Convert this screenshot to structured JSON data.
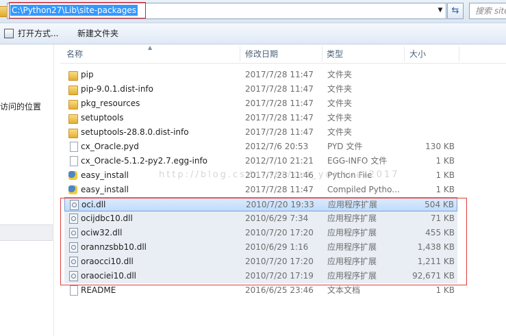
{
  "address_bar": {
    "path": "C:\\Python27\\Lib\\site-packages",
    "dropdown_icon": "chevron-down-icon",
    "refresh_icon": "refresh-icon",
    "search_placeholder": "搜索 site"
  },
  "toolbar": {
    "open_with_label": "打开方式...",
    "new_folder_label": "新建文件夹"
  },
  "nav_pane": {
    "recent_places_label": "访问的位置"
  },
  "columns": {
    "name": "名称",
    "date": "修改日期",
    "type": "类型",
    "size": "大小"
  },
  "watermark": "http://blog.csdn.net/cui_yonhua/2017",
  "files": [
    {
      "name": "pip",
      "date": "2017/7/28 11:47",
      "type": "文件夹",
      "size": "",
      "icon": "folder-icon"
    },
    {
      "name": "pip-9.0.1.dist-info",
      "date": "2017/7/28 11:47",
      "type": "文件夹",
      "size": "",
      "icon": "folder-icon"
    },
    {
      "name": "pkg_resources",
      "date": "2017/7/28 11:47",
      "type": "文件夹",
      "size": "",
      "icon": "folder-icon"
    },
    {
      "name": "setuptools",
      "date": "2017/7/28 11:47",
      "type": "文件夹",
      "size": "",
      "icon": "folder-icon"
    },
    {
      "name": "setuptools-28.8.0.dist-info",
      "date": "2017/7/28 11:47",
      "type": "文件夹",
      "size": "",
      "icon": "folder-icon"
    },
    {
      "name": "cx_Oracle.pyd",
      "date": "2012/7/6 20:53",
      "type": "PYD 文件",
      "size": "130 KB",
      "icon": "file-icon"
    },
    {
      "name": "cx_Oracle-5.1.2-py2.7.egg-info",
      "date": "2012/7/10 21:21",
      "type": "EGG-INFO 文件",
      "size": "1 KB",
      "icon": "file-icon"
    },
    {
      "name": "easy_install",
      "date": "2017/7/28 11:46",
      "type": "Python File",
      "size": "1 KB",
      "icon": "python-file-icon"
    },
    {
      "name": "easy_install",
      "date": "2017/7/28 11:47",
      "type": "Compiled Pytho...",
      "size": "1 KB",
      "icon": "python-compiled-icon"
    },
    {
      "name": "oci.dll",
      "date": "2010/7/20 19:33",
      "type": "应用程序扩展",
      "size": "504 KB",
      "icon": "dll-icon"
    },
    {
      "name": "ocijdbc10.dll",
      "date": "2010/6/29 7:34",
      "type": "应用程序扩展",
      "size": "71 KB",
      "icon": "dll-icon"
    },
    {
      "name": "ociw32.dll",
      "date": "2010/7/20 17:20",
      "type": "应用程序扩展",
      "size": "455 KB",
      "icon": "dll-icon"
    },
    {
      "name": "orannzsbb10.dll",
      "date": "2010/6/29 1:16",
      "type": "应用程序扩展",
      "size": "1,438 KB",
      "icon": "dll-icon"
    },
    {
      "name": "oraocci10.dll",
      "date": "2010/7/20 17:20",
      "type": "应用程序扩展",
      "size": "1,211 KB",
      "icon": "dll-icon"
    },
    {
      "name": "oraociei10.dll",
      "date": "2010/7/20 17:19",
      "type": "应用程序扩展",
      "size": "92,671 KB",
      "icon": "dll-icon"
    },
    {
      "name": "README",
      "date": "2016/6/25 23:46",
      "type": "文本文档",
      "size": "1 KB",
      "icon": "text-file-icon"
    }
  ],
  "colors": {
    "selection": "#3399ff",
    "highlight_frame": "#e53a3a"
  }
}
